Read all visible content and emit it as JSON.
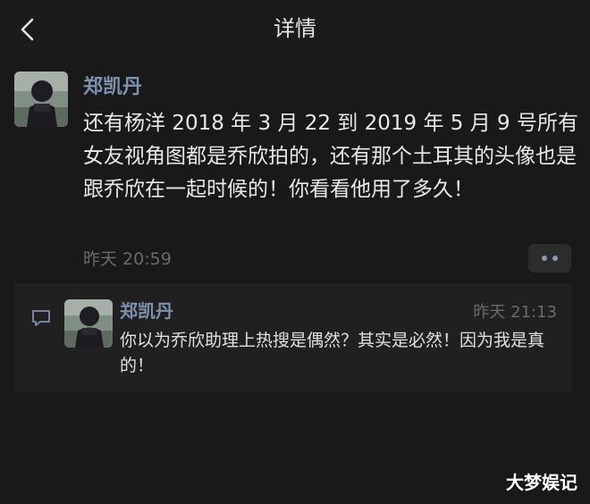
{
  "nav": {
    "title": "详情",
    "back_icon": "chevron-left-icon"
  },
  "post": {
    "author": "郑凯丹",
    "text": "还有杨洋 2018 年 3 月 22 到 2019 年 5 月 9 号所有女友视角图都是乔欣拍的，还有那个土耳其的头像也是跟乔欣在一起时候的！你看看他用了多久！",
    "time": "昨天 20:59",
    "more_icon": "more-dots-icon"
  },
  "comments": [
    {
      "author": "郑凯丹",
      "time": "昨天 21:13",
      "text": "你以为乔欣助理上热搜是偶然？其实是必然！因为我是真的！"
    }
  ],
  "comment_icon": "comment-bubble-icon",
  "watermark": "大梦娱记",
  "colors": {
    "background": "#191919",
    "name": "#7d90ad",
    "text": "#e8e8e8",
    "time": "#6a6a6a",
    "comment_panel": "#202020"
  }
}
